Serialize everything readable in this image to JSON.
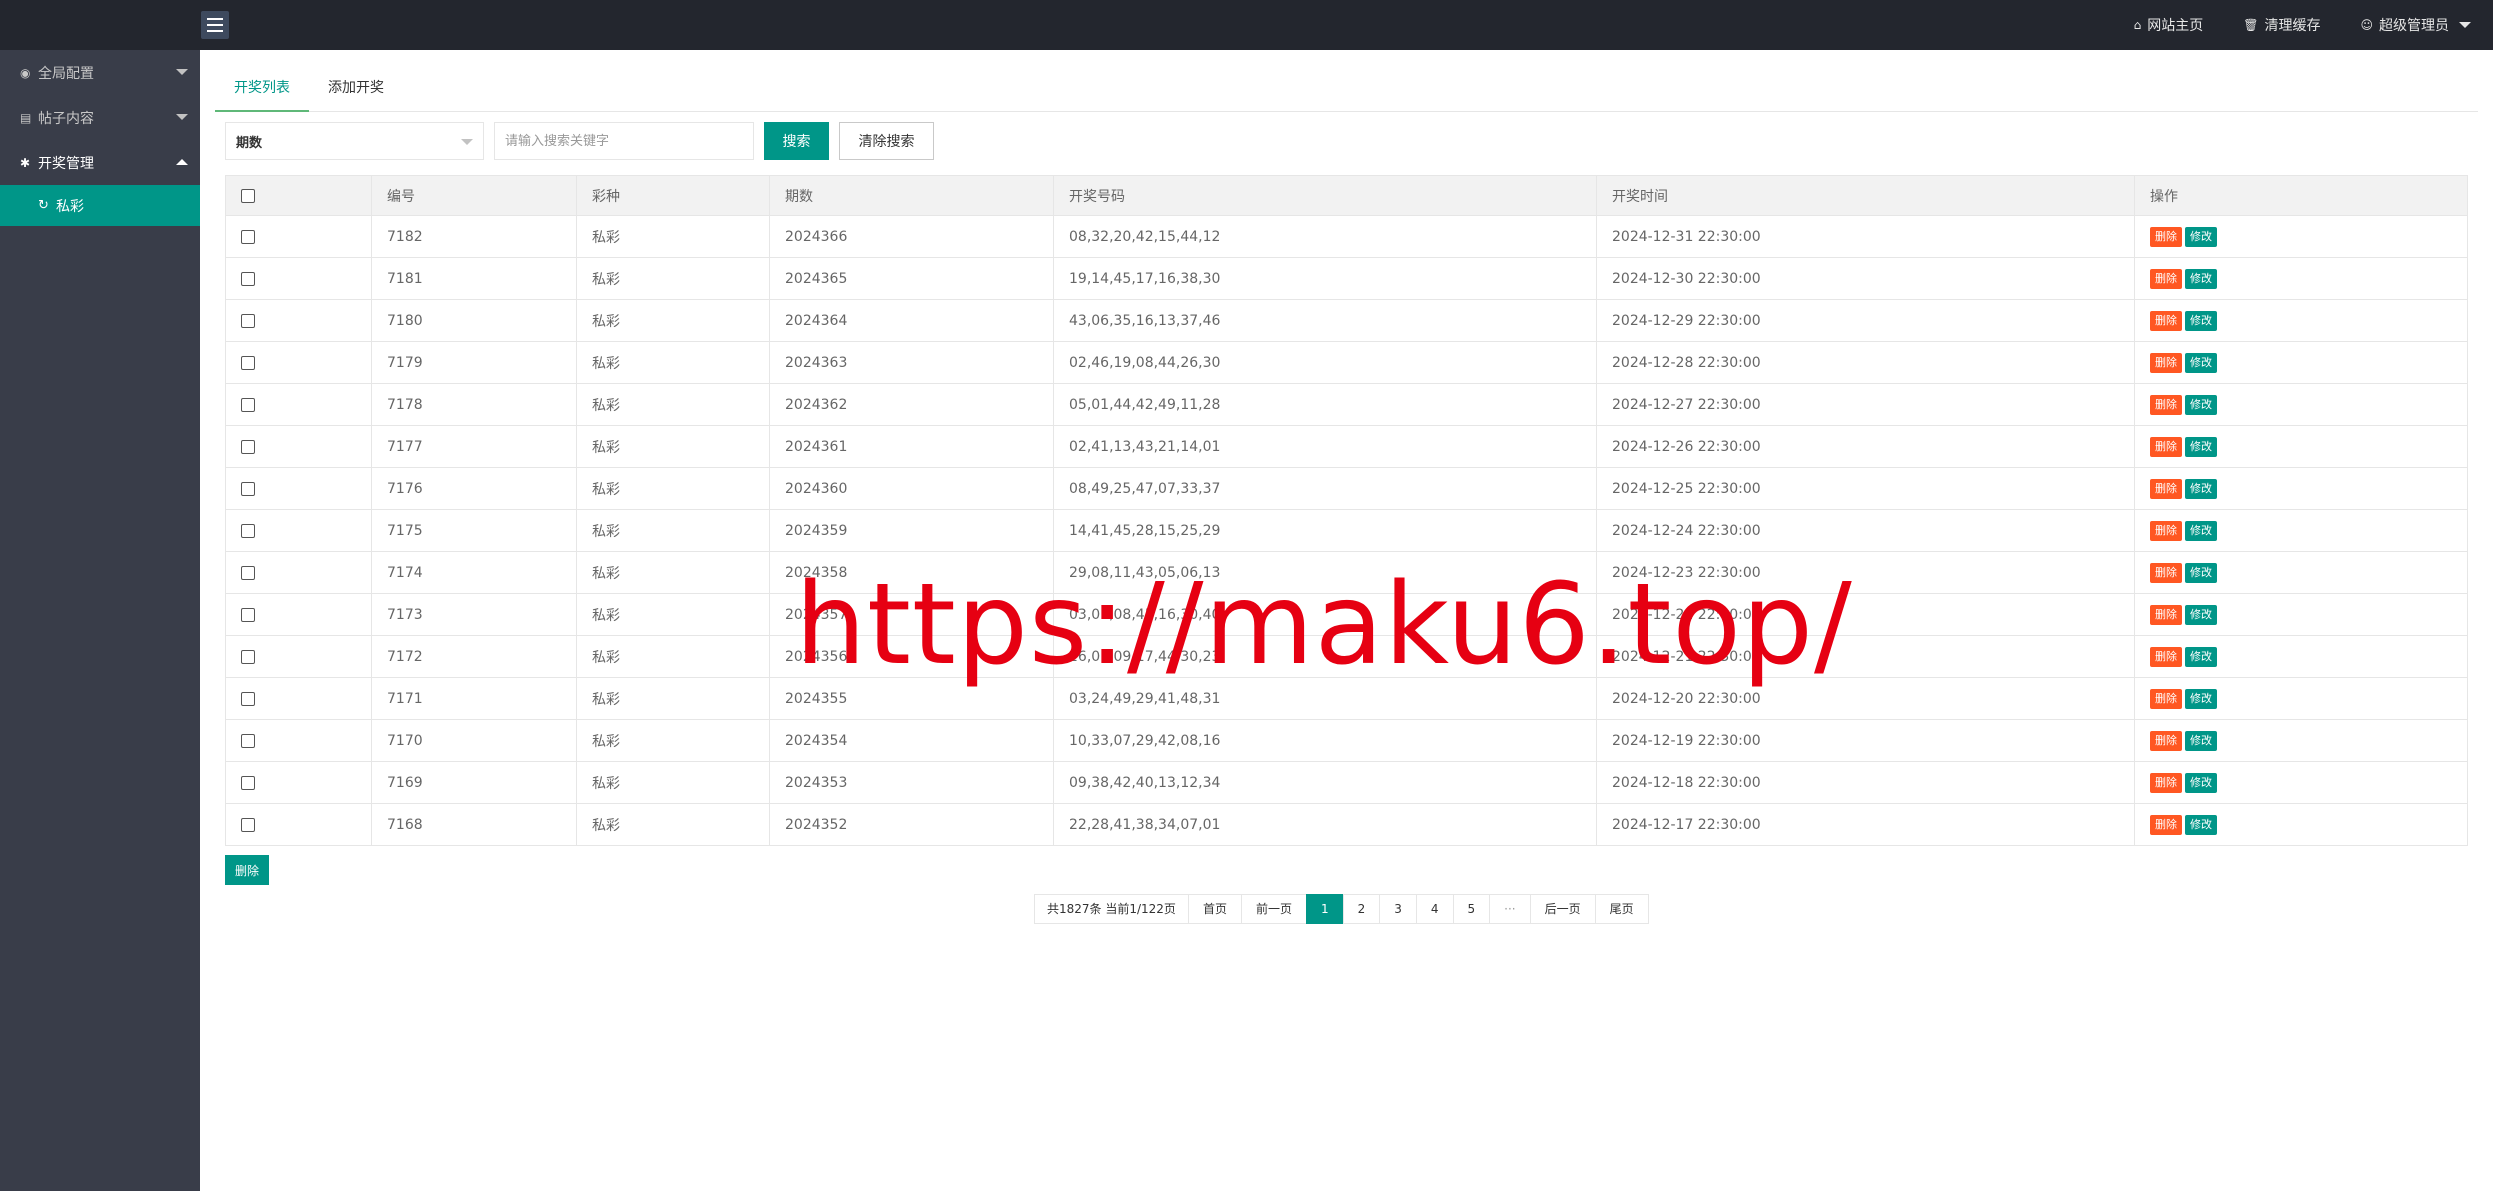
{
  "topbar": {
    "links": [
      {
        "icon": "home-icon",
        "glyph": "⌂",
        "label": "网站主页"
      },
      {
        "icon": "trash-icon",
        "glyph": "🗑",
        "label": "清理缓存"
      },
      {
        "icon": "user-icon",
        "glyph": "☺",
        "label": "超级管理员"
      }
    ]
  },
  "sidebar": {
    "items": [
      {
        "icon": "globe-icon",
        "glyph": "◉",
        "label": "全局配置",
        "expanded": false
      },
      {
        "icon": "document-icon",
        "glyph": "▤",
        "label": "帖子内容",
        "expanded": false
      },
      {
        "icon": "gear-icon",
        "glyph": "✱",
        "label": "开奖管理",
        "expanded": true
      }
    ],
    "sub_items": [
      {
        "icon": "history-icon",
        "glyph": "↻",
        "label": "私彩",
        "active": true
      }
    ]
  },
  "tabs": [
    {
      "label": "开奖列表",
      "active": true
    },
    {
      "label": "添加开奖",
      "active": false
    }
  ],
  "filter": {
    "select_value": "期数",
    "search_placeholder": "请输入搜索关键字",
    "search_button": "搜索",
    "clear_button": "清除搜索"
  },
  "table": {
    "headers": [
      "编号",
      "彩种",
      "期数",
      "开奖号码",
      "开奖时间",
      "操作"
    ],
    "delete_label": "删除",
    "edit_label": "修改",
    "rows": [
      {
        "id": "7182",
        "type": "私彩",
        "period": "2024366",
        "numbers": "08,32,20,42,15,44,12",
        "time": "2024-12-31 22:30:00"
      },
      {
        "id": "7181",
        "type": "私彩",
        "period": "2024365",
        "numbers": "19,14,45,17,16,38,30",
        "time": "2024-12-30 22:30:00"
      },
      {
        "id": "7180",
        "type": "私彩",
        "period": "2024364",
        "numbers": "43,06,35,16,13,37,46",
        "time": "2024-12-29 22:30:00"
      },
      {
        "id": "7179",
        "type": "私彩",
        "period": "2024363",
        "numbers": "02,46,19,08,44,26,30",
        "time": "2024-12-28 22:30:00"
      },
      {
        "id": "7178",
        "type": "私彩",
        "period": "2024362",
        "numbers": "05,01,44,42,49,11,28",
        "time": "2024-12-27 22:30:00"
      },
      {
        "id": "7177",
        "type": "私彩",
        "period": "2024361",
        "numbers": "02,41,13,43,21,14,01",
        "time": "2024-12-26 22:30:00"
      },
      {
        "id": "7176",
        "type": "私彩",
        "period": "2024360",
        "numbers": "08,49,25,47,07,33,37",
        "time": "2024-12-25 22:30:00"
      },
      {
        "id": "7175",
        "type": "私彩",
        "period": "2024359",
        "numbers": "14,41,45,28,15,25,29",
        "time": "2024-12-24 22:30:00"
      },
      {
        "id": "7174",
        "type": "私彩",
        "period": "2024358",
        "numbers": "29,08,11,43,05,06,13",
        "time": "2024-12-23 22:30:00"
      },
      {
        "id": "7173",
        "type": "私彩",
        "period": "2024357",
        "numbers": "03,01,08,45,16,30,40",
        "time": "2024-12-22 22:30:00"
      },
      {
        "id": "7172",
        "type": "私彩",
        "period": "2024356",
        "numbers": "26,01,09,17,44,30,23",
        "time": "2024-12-21 22:30:00"
      },
      {
        "id": "7171",
        "type": "私彩",
        "period": "2024355",
        "numbers": "03,24,49,29,41,48,31",
        "time": "2024-12-20 22:30:00"
      },
      {
        "id": "7170",
        "type": "私彩",
        "period": "2024354",
        "numbers": "10,33,07,29,42,08,16",
        "time": "2024-12-19 22:30:00"
      },
      {
        "id": "7169",
        "type": "私彩",
        "period": "2024353",
        "numbers": "09,38,42,40,13,12,34",
        "time": "2024-12-18 22:30:00"
      },
      {
        "id": "7168",
        "type": "私彩",
        "period": "2024352",
        "numbers": "22,28,41,38,34,07,01",
        "time": "2024-12-17 22:30:00"
      }
    ]
  },
  "bulk_delete_label": "删除",
  "pager": {
    "info": "共1827条 当前1/122页",
    "first": "首页",
    "prev": "前一页",
    "pages": [
      "1",
      "2",
      "3",
      "4",
      "5"
    ],
    "current": "1",
    "ellipsis": "···",
    "next": "后一页",
    "last": "尾页"
  },
  "watermark": "https://maku6.top/",
  "colors": {
    "accent": "#009688",
    "danger": "#ff5722",
    "sidebar": "#393d49",
    "topbar": "#23262e"
  }
}
